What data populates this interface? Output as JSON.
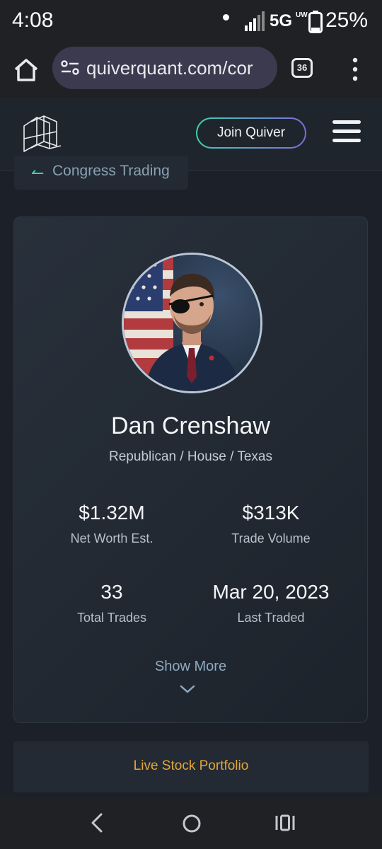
{
  "status_bar": {
    "time": "4:08",
    "network": "5G",
    "network_sub": "UW",
    "battery_pct": "25%",
    "battery_level": 0.25
  },
  "browser": {
    "url": "quiverquant.com/cor",
    "tab_count": "36"
  },
  "site_header": {
    "join_label": "Join Quiver"
  },
  "back_link": {
    "label": "Congress Trading"
  },
  "profile": {
    "name": "Dan Crenshaw",
    "meta": "Republican / House / Texas",
    "stats": [
      {
        "value": "$1.32M",
        "label": "Net Worth Est."
      },
      {
        "value": "$313K",
        "label": "Trade Volume"
      },
      {
        "value": "33",
        "label": "Total Trades"
      },
      {
        "value": "Mar 20, 2023",
        "label": "Last Traded"
      }
    ],
    "show_more_label": "Show More"
  },
  "portfolio": {
    "label": "Live Stock Portfolio"
  },
  "colors": {
    "accent_teal": "#3fd0b3",
    "accent_purple": "#7f6bd8",
    "portfolio_orange": "#e3a63a",
    "page_bg": "#1c2129"
  },
  "icons": [
    "home-icon",
    "tune-icon",
    "more-vert-icon",
    "quiver-logo",
    "hamburger-icon",
    "back-arrow-icon",
    "chevron-down-icon",
    "nav-back-icon",
    "nav-home-icon",
    "nav-recents-icon"
  ]
}
